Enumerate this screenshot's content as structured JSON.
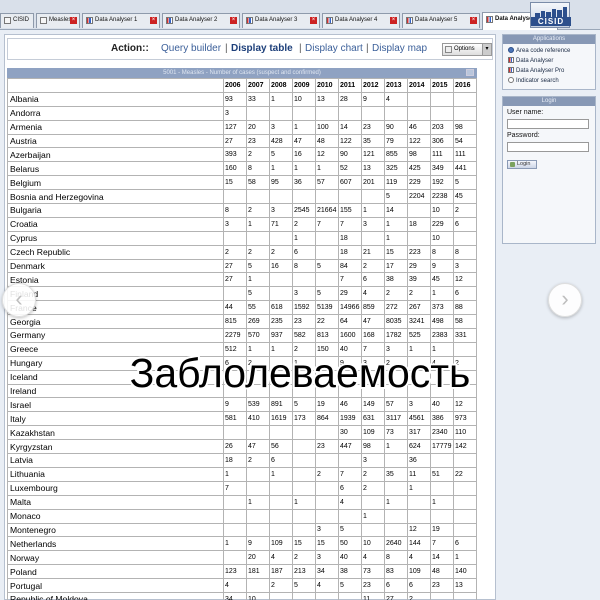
{
  "tabs": [
    {
      "label": "CISID",
      "icon": "home-icon",
      "active": false,
      "closable": false
    },
    {
      "label": "Measles",
      "icon": "page-icon",
      "active": false,
      "closable": true
    },
    {
      "label": "Data Analyser 1",
      "icon": "chart-icon",
      "active": false,
      "closable": true
    },
    {
      "label": "Data Analyser 2",
      "icon": "chart-icon",
      "active": false,
      "closable": true
    },
    {
      "label": "Data Analyser 3",
      "icon": "chart-icon",
      "active": false,
      "closable": true
    },
    {
      "label": "Data Analyser 4",
      "icon": "chart-icon",
      "active": false,
      "closable": true
    },
    {
      "label": "Data Analyser 5",
      "icon": "chart-icon",
      "active": false,
      "closable": true
    },
    {
      "label": "Data Analyser 6",
      "icon": "chart-icon",
      "active": true,
      "closable": true
    }
  ],
  "logo_text": "CISID",
  "action": {
    "label": "Action::",
    "links": [
      "Query builder",
      "Display table",
      "Display chart",
      "Display map"
    ],
    "active": "Display table",
    "separator": "|",
    "options_label": "Options"
  },
  "table": {
    "title": "5001 - Measles - Number of cases (suspect and confirmed)",
    "years": [
      "2006",
      "2007",
      "2008",
      "2009",
      "2010",
      "2011",
      "2012",
      "2013",
      "2014",
      "2015",
      "2016"
    ],
    "rows": [
      {
        "country": "Albania",
        "values": [
          "93",
          "33",
          "1",
          "10",
          "13",
          "28",
          "9",
          "4",
          "",
          "",
          ""
        ]
      },
      {
        "country": "Andorra",
        "values": [
          "3",
          "",
          "",
          "",
          "",
          "",
          "",
          "",
          "",
          "",
          ""
        ]
      },
      {
        "country": "Armenia",
        "values": [
          "127",
          "20",
          "3",
          "1",
          "100",
          "14",
          "23",
          "90",
          "46",
          "203",
          "98"
        ]
      },
      {
        "country": "Austria",
        "values": [
          "27",
          "23",
          "428",
          "47",
          "48",
          "122",
          "35",
          "79",
          "122",
          "306",
          "54"
        ]
      },
      {
        "country": "Azerbaijan",
        "values": [
          "393",
          "2",
          "5",
          "16",
          "12",
          "90",
          "121",
          "855",
          "98",
          "111",
          "111"
        ]
      },
      {
        "country": "Belarus",
        "values": [
          "160",
          "8",
          "1",
          "1",
          "1",
          "52",
          "13",
          "325",
          "425",
          "349",
          "441"
        ]
      },
      {
        "country": "Belgium",
        "values": [
          "15",
          "58",
          "95",
          "36",
          "57",
          "607",
          "201",
          "119",
          "229",
          "192",
          "5"
        ]
      },
      {
        "country": "Bosnia and Herzegovina",
        "values": [
          "",
          "",
          "",
          "",
          "",
          "",
          "",
          "5",
          "2204",
          "2238",
          "45"
        ]
      },
      {
        "country": "Bulgaria",
        "values": [
          "8",
          "2",
          "3",
          "2545",
          "21664",
          "155",
          "1",
          "14",
          "",
          "10",
          "2"
        ]
      },
      {
        "country": "Croatia",
        "values": [
          "3",
          "1",
          "71",
          "2",
          "7",
          "7",
          "3",
          "1",
          "18",
          "229",
          "6"
        ]
      },
      {
        "country": "Cyprus",
        "values": [
          "",
          "",
          "",
          "1",
          "",
          "18",
          "",
          "1",
          "",
          "10",
          ""
        ]
      },
      {
        "country": "Czech Republic",
        "values": [
          "2",
          "2",
          "2",
          "6",
          "",
          "18",
          "21",
          "15",
          "223",
          "8",
          "8"
        ]
      },
      {
        "country": "Denmark",
        "values": [
          "27",
          "5",
          "16",
          "8",
          "5",
          "84",
          "2",
          "17",
          "29",
          "9",
          "3"
        ]
      },
      {
        "country": "Estonia",
        "values": [
          "27",
          "1",
          "",
          "",
          "",
          "7",
          "6",
          "38",
          "39",
          "45",
          "12"
        ]
      },
      {
        "country": "Finland",
        "values": [
          "",
          "5",
          "",
          "3",
          "5",
          "29",
          "4",
          "2",
          "2",
          "1",
          "6"
        ]
      },
      {
        "country": "France",
        "values": [
          "44",
          "55",
          "618",
          "1592",
          "5139",
          "14966",
          "859",
          "272",
          "267",
          "373",
          "88"
        ]
      },
      {
        "country": "Georgia",
        "values": [
          "815",
          "269",
          "235",
          "23",
          "22",
          "64",
          "47",
          "8035",
          "3241",
          "498",
          "58"
        ]
      },
      {
        "country": "Germany",
        "values": [
          "2279",
          "570",
          "937",
          "582",
          "813",
          "1600",
          "168",
          "1782",
          "525",
          "2383",
          "331"
        ]
      },
      {
        "country": "Greece",
        "values": [
          "512",
          "1",
          "1",
          "2",
          "150",
          "40",
          "7",
          "3",
          "1",
          "1",
          ""
        ]
      },
      {
        "country": "Hungary",
        "values": [
          "6",
          "2",
          "",
          "1",
          "",
          "9",
          "3",
          "2",
          "",
          "4",
          "2"
        ]
      },
      {
        "country": "Iceland",
        "values": [
          "",
          "",
          "",
          "",
          "",
          "",
          "",
          "",
          "",
          "",
          ""
        ]
      },
      {
        "country": "Ireland",
        "values": [
          "",
          "",
          "",
          "",
          "",
          "",
          "",
          "",
          "",
          "",
          ""
        ]
      },
      {
        "country": "Israel",
        "values": [
          "9",
          "539",
          "891",
          "5",
          "19",
          "46",
          "149",
          "57",
          "3",
          "40",
          "12"
        ]
      },
      {
        "country": "Italy",
        "values": [
          "581",
          "410",
          "1619",
          "173",
          "864",
          "1939",
          "631",
          "3117",
          "4561",
          "386",
          "973"
        ]
      },
      {
        "country": "Kazakhstan",
        "values": [
          "",
          "",
          "",
          "",
          "",
          "30",
          "109",
          "73",
          "317",
          "2340",
          "110"
        ]
      },
      {
        "country": "Kyrgyzstan",
        "values": [
          "26",
          "47",
          "56",
          "",
          "23",
          "447",
          "98",
          "1",
          "624",
          "17779",
          "142"
        ]
      },
      {
        "country": "Latvia",
        "values": [
          "18",
          "2",
          "6",
          "",
          "",
          "",
          "3",
          "",
          "36",
          "",
          ""
        ]
      },
      {
        "country": "Lithuania",
        "values": [
          "1",
          "",
          "1",
          "",
          "2",
          "7",
          "2",
          "35",
          "11",
          "51",
          "22"
        ]
      },
      {
        "country": "Luxembourg",
        "values": [
          "7",
          "",
          "",
          "",
          "",
          "6",
          "2",
          "",
          "1",
          "",
          ""
        ]
      },
      {
        "country": "Malta",
        "values": [
          "",
          "1",
          "",
          "1",
          "",
          "4",
          "",
          "1",
          "",
          "1",
          ""
        ]
      },
      {
        "country": "Monaco",
        "values": [
          "",
          "",
          "",
          "",
          "",
          "",
          "1",
          "",
          "",
          "",
          ""
        ]
      },
      {
        "country": "Montenegro",
        "values": [
          "",
          "",
          "",
          "",
          "3",
          "5",
          "",
          "",
          "12",
          "19",
          ""
        ]
      },
      {
        "country": "Netherlands",
        "values": [
          "1",
          "9",
          "109",
          "15",
          "15",
          "50",
          "10",
          "2640",
          "144",
          "7",
          "6"
        ]
      },
      {
        "country": "Norway",
        "values": [
          "",
          "20",
          "4",
          "2",
          "3",
          "40",
          "4",
          "8",
          "4",
          "14",
          "1"
        ]
      },
      {
        "country": "Poland",
        "values": [
          "123",
          "181",
          "187",
          "213",
          "34",
          "38",
          "73",
          "83",
          "109",
          "48",
          "140"
        ]
      },
      {
        "country": "Portugal",
        "values": [
          "4",
          "",
          "2",
          "5",
          "4",
          "5",
          "23",
          "6",
          "6",
          "23",
          "13"
        ]
      },
      {
        "country": "Republic of Moldova",
        "values": [
          "34",
          "10",
          "",
          "",
          "",
          "",
          "11",
          "27",
          "2",
          "",
          ""
        ]
      }
    ]
  },
  "sidebar": {
    "applications_title": "Applications",
    "applications": [
      {
        "label": "Area code reference",
        "icon": "globe-icon"
      },
      {
        "label": "Data Analyser",
        "icon": "chart-icon"
      },
      {
        "label": "Data Analyser Pro",
        "icon": "chart-icon"
      },
      {
        "label": "Indicator search",
        "icon": "magnifier-icon"
      }
    ],
    "login_title": "Login",
    "username_label": "User name:",
    "password_label": "Password:",
    "login_button": "Login"
  },
  "overlay_caption": "Заблолеваемость",
  "nav": {
    "prev": "‹",
    "next": "›"
  }
}
